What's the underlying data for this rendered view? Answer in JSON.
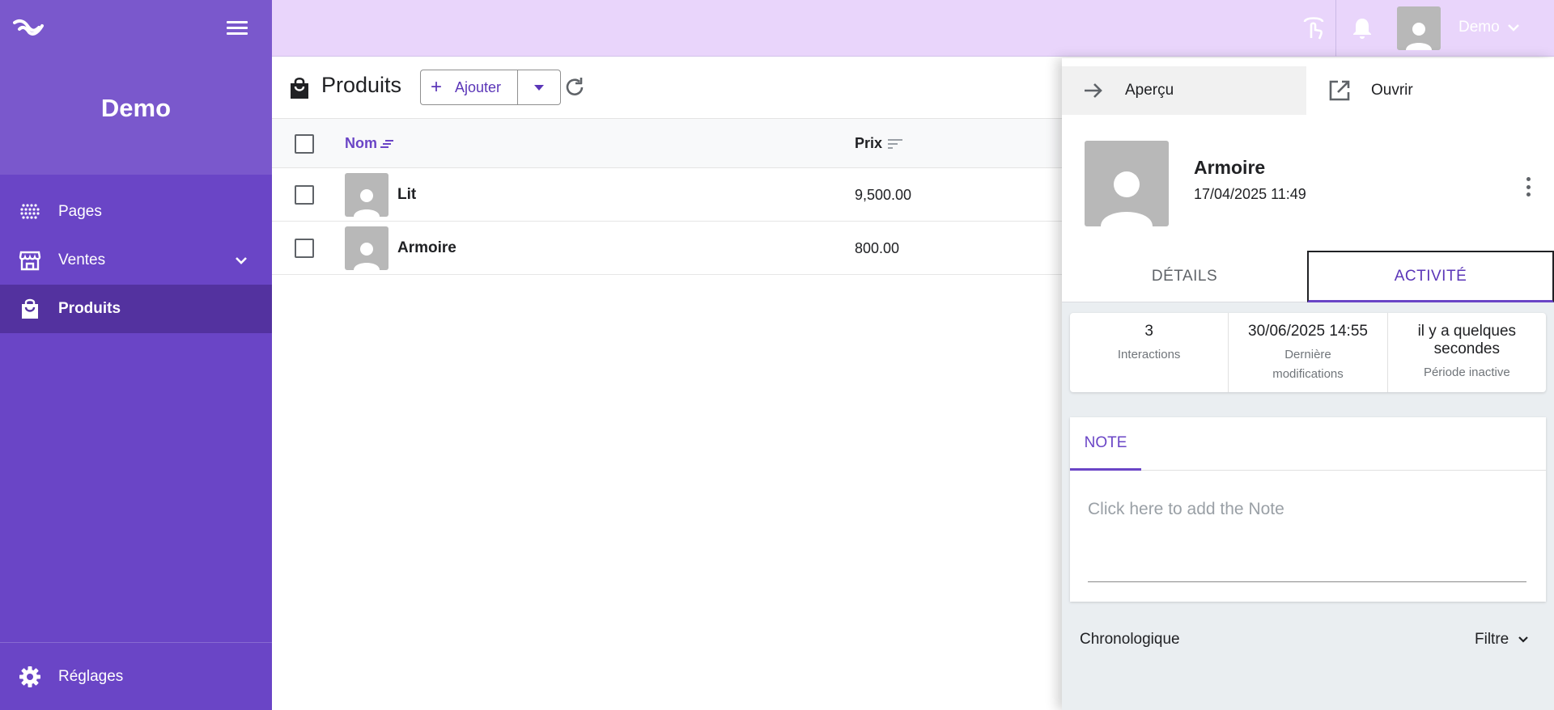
{
  "sidebar": {
    "brand": "Demo",
    "items": [
      {
        "label": "Pages",
        "icon": "dots-grid-icon"
      },
      {
        "label": "Ventes",
        "icon": "store-icon"
      },
      {
        "label": "Produits",
        "icon": "shopping-bag-icon"
      }
    ],
    "settings_label": "Réglages"
  },
  "topbar": {
    "user_name": "Demo"
  },
  "main": {
    "title": "Produits",
    "add_label": "Ajouter",
    "columns": {
      "name": "Nom",
      "price": "Prix"
    },
    "rows": [
      {
        "name": "Lit",
        "price": "9,500.00"
      },
      {
        "name": "Armoire",
        "price": "800.00"
      }
    ]
  },
  "panel": {
    "preview_label": "Aperçu",
    "open_label": "Ouvrir",
    "record_name": "Armoire",
    "record_date": "17/04/2025 11:49",
    "tabs": {
      "details": "DÉTAILS",
      "activity": "ACTIVITÉ"
    },
    "stats": [
      {
        "value": "3",
        "label": "Interactions"
      },
      {
        "value": "30/06/2025 14:55",
        "label": "Dernière modifications"
      },
      {
        "value": "il y a quelques secondes",
        "label": "Période inactive"
      }
    ],
    "note_tab": "NOTE",
    "note_placeholder": "Click here to add the Note",
    "timeline_label": "Chronologique",
    "filter_label": "Filtre"
  },
  "colors": {
    "sidebar": "#6a45c6",
    "sidebar_top": "#7a58cc",
    "sidebar_active": "#53329f",
    "topbar": "#e9d5fb",
    "accent": "#5b36b8"
  }
}
